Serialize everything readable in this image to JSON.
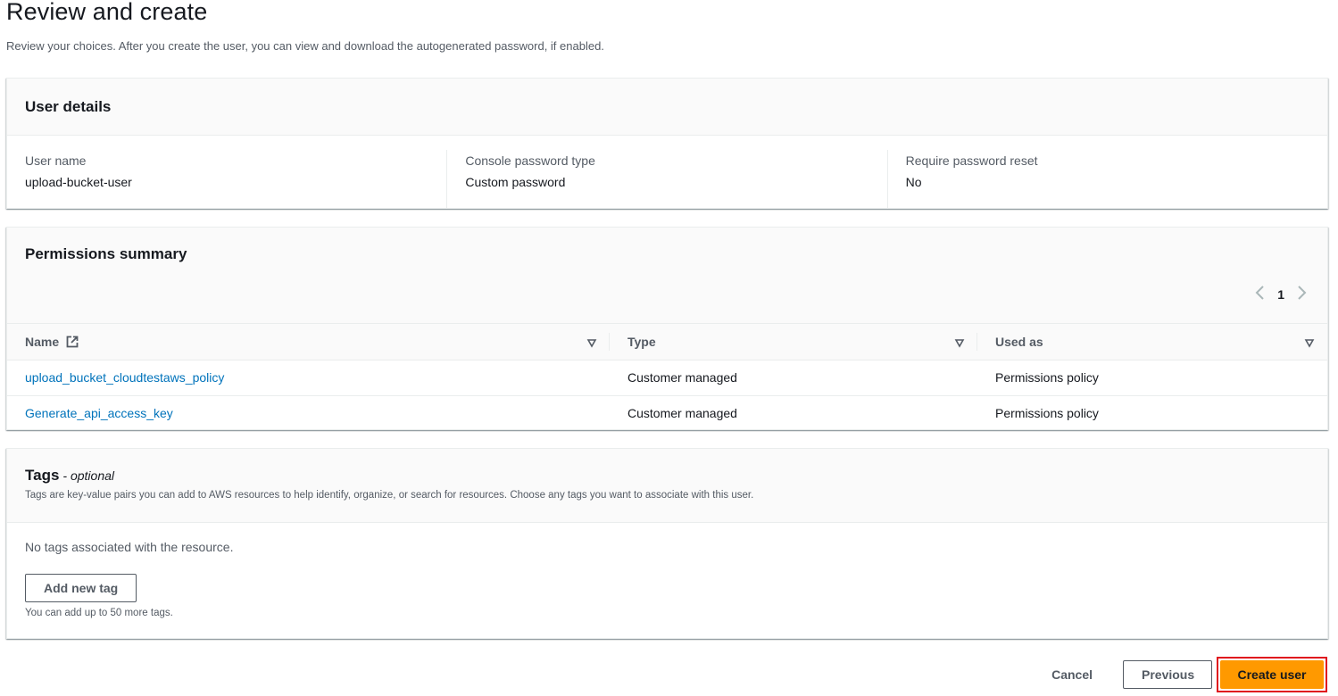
{
  "page": {
    "title": "Review and create",
    "description": "Review your choices. After you create the user, you can view and download the autogenerated password, if enabled."
  },
  "user_details": {
    "title": "User details",
    "fields": [
      {
        "label": "User name",
        "value": "upload-bucket-user"
      },
      {
        "label": "Console password type",
        "value": "Custom password"
      },
      {
        "label": "Require password reset",
        "value": "No"
      }
    ]
  },
  "permissions": {
    "title": "Permissions summary",
    "pagination": {
      "prev_icon": "chevron-left-icon",
      "page": "1",
      "next_icon": "chevron-right-icon"
    },
    "columns": [
      {
        "label": "Name",
        "icon": "external-link-icon",
        "sort_icon": "sort-down-icon"
      },
      {
        "label": "Type",
        "sort_icon": "sort-down-icon"
      },
      {
        "label": "Used as",
        "sort_icon": "sort-down-icon"
      }
    ],
    "rows": [
      {
        "name": "upload_bucket_cloudtestaws_policy",
        "type": "Customer managed",
        "used_as": "Permissions policy"
      },
      {
        "name": "Generate_api_access_key",
        "type": "Customer managed",
        "used_as": "Permissions policy"
      }
    ]
  },
  "tags": {
    "title": "Tags",
    "optional_label": "- optional",
    "description": "Tags are key-value pairs you can add to AWS resources to help identify, organize, or search for resources. Choose any tags you want to associate with this user.",
    "empty_text": "No tags associated with the resource.",
    "add_button": "Add new tag",
    "hint": "You can add up to 50 more tags."
  },
  "actions": {
    "cancel": "Cancel",
    "previous": "Previous",
    "create": "Create user"
  },
  "colors": {
    "primary": "#ff9900",
    "link": "#0073bb",
    "highlight": "#e0161e"
  }
}
